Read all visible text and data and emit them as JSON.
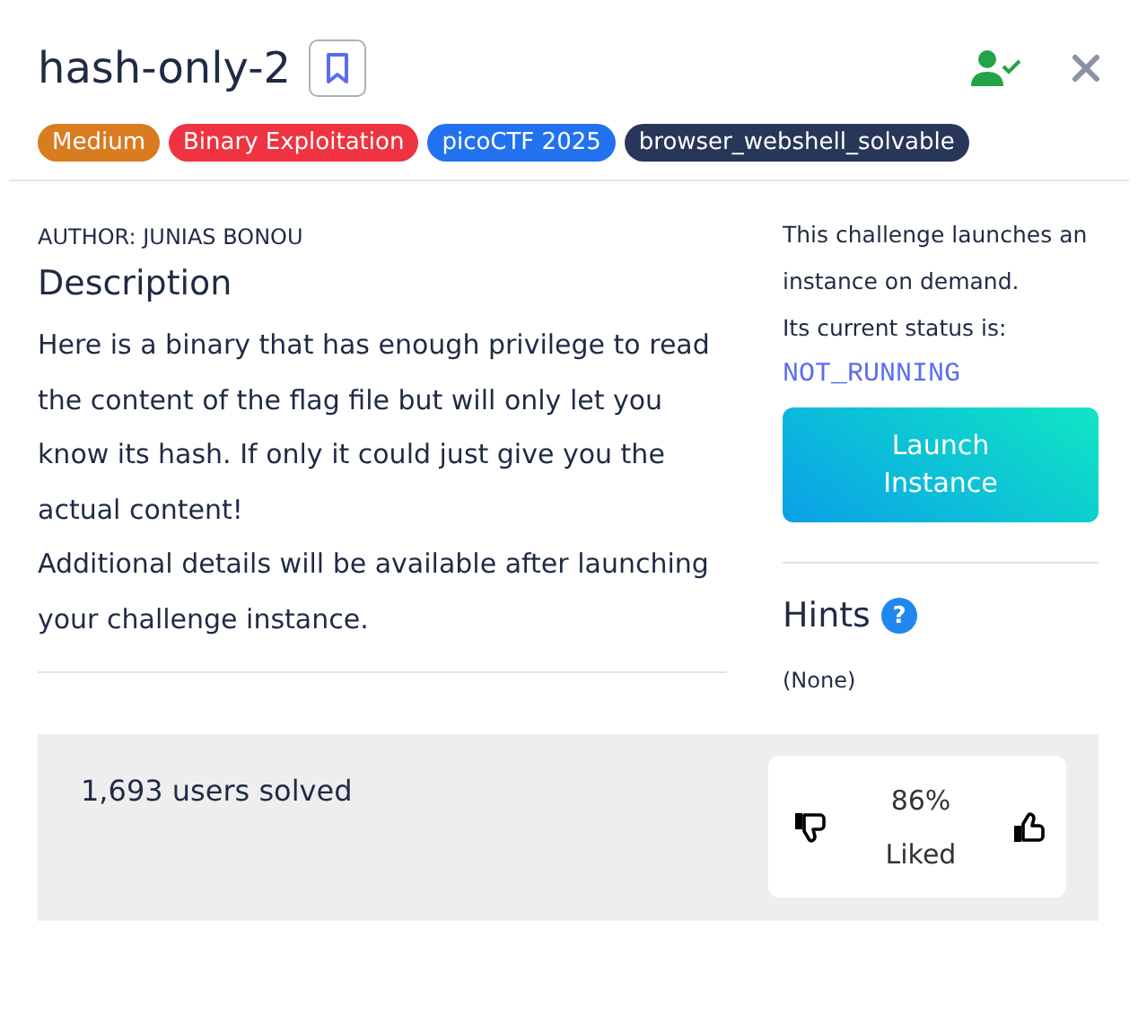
{
  "title": "hash-only-2",
  "tags": [
    {
      "label": "Medium",
      "color": "#d97b1f"
    },
    {
      "label": "Binary Exploitation",
      "color": "#ef3340"
    },
    {
      "label": "picoCTF 2025",
      "color": "#2271ef"
    },
    {
      "label": "browser_webshell_solvable",
      "color": "#28365a"
    }
  ],
  "author": "AUTHOR: JUNIAS BONOU",
  "description": {
    "heading": "Description",
    "paragraphs": [
      "Here is a binary that has enough privilege to read the content of the flag file but will only let you know its hash. If only it could just give you the actual content!",
      "Additional details will be available after launching your challenge instance."
    ]
  },
  "instance": {
    "info": [
      "This challenge launches an instance on demand.",
      "Its current status is:"
    ],
    "status": "NOT_RUNNING",
    "button": "Launch Instance"
  },
  "hints": {
    "heading": "Hints",
    "help_icon": "?",
    "text": "(None)"
  },
  "stats": {
    "solved": "1,693 users solved",
    "liked_percent": "86%",
    "liked_label": "Liked"
  }
}
